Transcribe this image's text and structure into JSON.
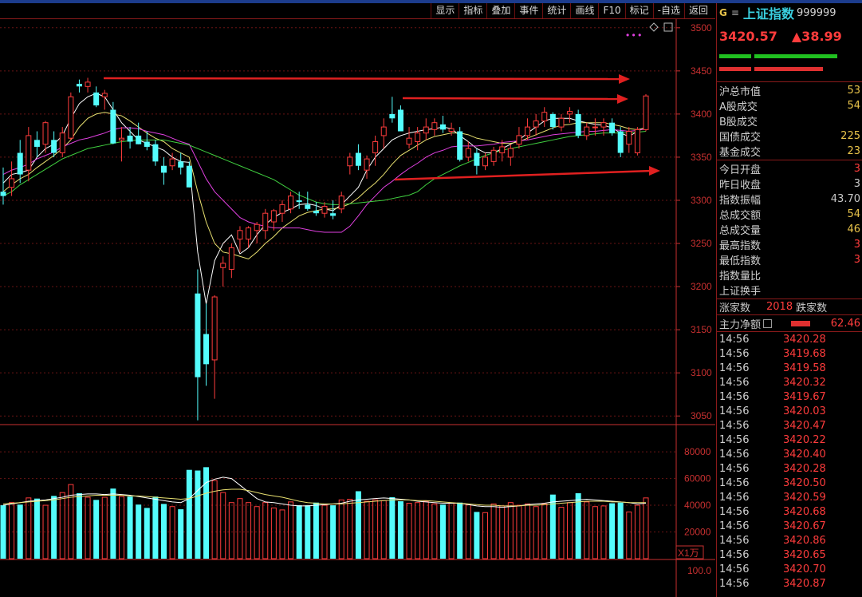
{
  "toolbar": [
    "显示",
    "指标",
    "叠加",
    "事件",
    "统计",
    "画线",
    "F10",
    "标记",
    "-自选",
    "返回"
  ],
  "header": {
    "g": "G",
    "menu": "≡",
    "name": "上证指数",
    "code": "999999"
  },
  "quote": {
    "price": "3420.57",
    "change": "▲38.99"
  },
  "stats": [
    {
      "label": "沪总市值",
      "value": "53",
      "color": "yellow"
    },
    {
      "label": "A股成交",
      "value": "54",
      "color": "yellow"
    },
    {
      "label": "B股成交",
      "value": "",
      "color": "yellow"
    },
    {
      "label": "国债成交",
      "value": "225",
      "color": "yellow"
    },
    {
      "label": "基金成交",
      "value": "23",
      "color": "yellow"
    }
  ],
  "stats2": [
    {
      "label": "今日开盘",
      "value": "3",
      "color": "red"
    },
    {
      "label": "昨日收盘",
      "value": "3",
      "color": "white"
    },
    {
      "label": "指数振幅",
      "value": "43.70",
      "color": "white"
    },
    {
      "label": "总成交额",
      "value": "54",
      "color": "yellow"
    },
    {
      "label": "总成交量",
      "value": "46",
      "color": "yellow"
    },
    {
      "label": "最高指数",
      "value": "3",
      "color": "red"
    },
    {
      "label": "最低指数",
      "value": "3",
      "color": "red"
    },
    {
      "label": "指数量比",
      "value": "",
      "color": "white"
    },
    {
      "label": "上证换手",
      "value": "",
      "color": "white"
    }
  ],
  "updown": {
    "up_label": "涨家数",
    "up_value": "2018",
    "down_label": "跌家数"
  },
  "netflow": {
    "label": "主力净额",
    "value": "62.46"
  },
  "ticks": [
    {
      "t": "14:56",
      "p": "3420.28"
    },
    {
      "t": "14:56",
      "p": "3419.68"
    },
    {
      "t": "14:56",
      "p": "3419.58"
    },
    {
      "t": "14:56",
      "p": "3420.32"
    },
    {
      "t": "14:56",
      "p": "3419.67"
    },
    {
      "t": "14:56",
      "p": "3420.03"
    },
    {
      "t": "14:56",
      "p": "3420.47"
    },
    {
      "t": "14:56",
      "p": "3420.22"
    },
    {
      "t": "14:56",
      "p": "3420.40"
    },
    {
      "t": "14:56",
      "p": "3420.28"
    },
    {
      "t": "14:56",
      "p": "3420.50"
    },
    {
      "t": "14:56",
      "p": "3420.59"
    },
    {
      "t": "14:56",
      "p": "3420.68"
    },
    {
      "t": "14:56",
      "p": "3420.67"
    },
    {
      "t": "14:56",
      "p": "3420.86"
    },
    {
      "t": "14:56",
      "p": "3420.65"
    },
    {
      "t": "14:56",
      "p": "3420.70"
    },
    {
      "t": "14:56",
      "p": "3420.87"
    }
  ],
  "colors": {
    "up": "#ff3c3c",
    "down": "#54fcfc",
    "ma5": "#ffffff",
    "ma10": "#e8e070",
    "ma20": "#e040e0",
    "ma60": "#40d040",
    "axis": "#c83030"
  },
  "chart_data": {
    "type": "candlestick",
    "price_axis": {
      "ticks": [
        3050,
        3100,
        3150,
        3200,
        3250,
        3300,
        3350,
        3400,
        3450,
        3500
      ],
      "range": [
        3040,
        3510
      ]
    },
    "volume_axis": {
      "ticks": [
        20000,
        40000,
        60000,
        80000
      ],
      "unit_label": "X1万",
      "range": [
        0,
        95000
      ]
    },
    "sub_axis": {
      "ticks": [
        "100.0"
      ]
    },
    "candles": [
      [
        3310,
        3338,
        3295,
        3305,
        40000
      ],
      [
        3315,
        3345,
        3305,
        3325,
        42000
      ],
      [
        3355,
        3370,
        3320,
        3330,
        40500
      ],
      [
        3335,
        3385,
        3322,
        3375,
        45500
      ],
      [
        3370,
        3380,
        3350,
        3362,
        45000
      ],
      [
        3365,
        3392,
        3355,
        3390,
        40000
      ],
      [
        3370,
        3380,
        3350,
        3355,
        47000
      ],
      [
        3355,
        3385,
        3350,
        3378,
        49500
      ],
      [
        3372,
        3425,
        3370,
        3420,
        55500
      ],
      [
        3435,
        3440,
        3425,
        3432,
        49000
      ],
      [
        3432,
        3442,
        3425,
        3437,
        46000
      ],
      [
        3425,
        3432,
        3408,
        3410,
        44000
      ],
      [
        3420,
        3428,
        3405,
        3424,
        46000
      ],
      [
        3405,
        3414,
        3365,
        3366,
        52500
      ],
      [
        3370,
        3385,
        3345,
        3372,
        46500
      ],
      [
        3375,
        3385,
        3360,
        3368,
        46500
      ],
      [
        3375,
        3390,
        3365,
        3365,
        40500
      ],
      [
        3368,
        3380,
        3358,
        3362,
        38000
      ],
      [
        3365,
        3370,
        3340,
        3345,
        46500
      ],
      [
        3340,
        3350,
        3318,
        3332,
        41000
      ],
      [
        3340,
        3355,
        3335,
        3348,
        39000
      ],
      [
        3345,
        3355,
        3330,
        3338,
        37000
      ],
      [
        3340,
        3345,
        3315,
        3315,
        66500
      ],
      [
        3192,
        3220,
        3045,
        3095,
        66000
      ],
      [
        3145,
        3180,
        3085,
        3110,
        68500
      ],
      [
        3115,
        3190,
        3070,
        3188,
        58500
      ],
      [
        3222,
        3235,
        3200,
        3227,
        49500
      ],
      [
        3220,
        3250,
        3210,
        3245,
        42000
      ],
      [
        3255,
        3270,
        3240,
        3265,
        45000
      ],
      [
        3255,
        3270,
        3245,
        3268,
        42000
      ],
      [
        3265,
        3275,
        3250,
        3272,
        39000
      ],
      [
        3265,
        3290,
        3255,
        3285,
        42000
      ],
      [
        3275,
        3290,
        3265,
        3288,
        38000
      ],
      [
        3285,
        3300,
        3275,
        3295,
        36500
      ],
      [
        3290,
        3310,
        3285,
        3305,
        42500
      ],
      [
        3300,
        3310,
        3290,
        3298,
        40000
      ],
      [
        3295,
        3310,
        3288,
        3290,
        40000
      ],
      [
        3288,
        3298,
        3282,
        3285,
        42000
      ],
      [
        3285,
        3298,
        3280,
        3293,
        40000
      ],
      [
        3285,
        3300,
        3278,
        3282,
        40000
      ],
      [
        3290,
        3310,
        3285,
        3305,
        44000
      ],
      [
        3340,
        3355,
        3330,
        3350,
        44500
      ],
      [
        3355,
        3365,
        3335,
        3340,
        50500
      ],
      [
        3335,
        3352,
        3325,
        3348,
        43000
      ],
      [
        3355,
        3375,
        3340,
        3368,
        44000
      ],
      [
        3375,
        3395,
        3360,
        3385,
        43500
      ],
      [
        3400,
        3420,
        3390,
        3395,
        46000
      ],
      [
        3405,
        3410,
        3380,
        3380,
        43000
      ],
      [
        3365,
        3385,
        3360,
        3372,
        41500
      ],
      [
        3368,
        3385,
        3358,
        3378,
        42000
      ],
      [
        3378,
        3395,
        3370,
        3385,
        43000
      ],
      [
        3382,
        3395,
        3375,
        3390,
        41000
      ],
      [
        3388,
        3398,
        3378,
        3382,
        40500
      ],
      [
        3380,
        3390,
        3375,
        3383,
        41500
      ],
      [
        3380,
        3385,
        3345,
        3347,
        42000
      ],
      [
        3350,
        3368,
        3345,
        3360,
        40500
      ],
      [
        3355,
        3360,
        3330,
        3340,
        35000
      ],
      [
        3340,
        3355,
        3335,
        3350,
        34500
      ],
      [
        3345,
        3362,
        3340,
        3358,
        41000
      ],
      [
        3355,
        3370,
        3345,
        3362,
        39500
      ],
      [
        3350,
        3365,
        3340,
        3360,
        42000
      ],
      [
        3365,
        3385,
        3360,
        3375,
        40000
      ],
      [
        3375,
        3395,
        3370,
        3385,
        41000
      ],
      [
        3385,
        3400,
        3375,
        3392,
        39000
      ],
      [
        3392,
        3408,
        3385,
        3402,
        41000
      ],
      [
        3400,
        3402,
        3382,
        3385,
        48000
      ],
      [
        3385,
        3400,
        3380,
        3395,
        38500
      ],
      [
        3400,
        3408,
        3390,
        3403,
        42000
      ],
      [
        3400,
        3405,
        3372,
        3375,
        49000
      ],
      [
        3375,
        3390,
        3370,
        3385,
        42500
      ],
      [
        3385,
        3395,
        3375,
        3385,
        39000
      ],
      [
        3385,
        3395,
        3375,
        3390,
        39500
      ],
      [
        3390,
        3395,
        3375,
        3378,
        41500
      ],
      [
        3380,
        3385,
        3350,
        3355,
        42000
      ],
      [
        3365,
        3385,
        3355,
        3380,
        35000
      ],
      [
        3355,
        3385,
        3352,
        3382,
        40000
      ],
      [
        3382,
        3423,
        3380,
        3421,
        45500
      ]
    ],
    "ma_lines": [
      {
        "name": "ma5",
        "values": [
          3320,
          3330,
          3332,
          3335,
          3350,
          3360,
          3365,
          3375,
          3395,
          3412,
          3420,
          3424,
          3420,
          3405,
          3390,
          3380,
          3370,
          3366,
          3362,
          3358,
          3350,
          3345,
          3344,
          3240,
          3180,
          3230,
          3250,
          3260,
          3238,
          3245,
          3260,
          3272,
          3280,
          3286,
          3290,
          3295,
          3296,
          3294,
          3290,
          3288,
          3295,
          3305,
          3315,
          3335,
          3350,
          3360,
          3370,
          3375,
          3378,
          3380,
          3382,
          3383,
          3385,
          3383,
          3375,
          3368,
          3360,
          3355,
          3355,
          3360,
          3365,
          3370,
          3378,
          3385,
          3392,
          3395,
          3395,
          3395,
          3392,
          3390,
          3388,
          3387,
          3384,
          3378,
          3374,
          3380,
          3385
        ]
      },
      {
        "name": "ma10",
        "values": [
          3310,
          3318,
          3325,
          3330,
          3338,
          3345,
          3352,
          3360,
          3370,
          3385,
          3395,
          3400,
          3402,
          3400,
          3398,
          3392,
          3385,
          3378,
          3372,
          3368,
          3360,
          3355,
          3350,
          3310,
          3275,
          3250,
          3240,
          3238,
          3235,
          3232,
          3240,
          3250,
          3258,
          3268,
          3275,
          3282,
          3286,
          3288,
          3290,
          3290,
          3292,
          3296,
          3303,
          3312,
          3320,
          3330,
          3342,
          3352,
          3358,
          3364,
          3370,
          3374,
          3376,
          3378,
          3378,
          3376,
          3372,
          3370,
          3368,
          3366,
          3366,
          3368,
          3372,
          3376,
          3380,
          3384,
          3387,
          3388,
          3390,
          3390,
          3390,
          3390,
          3388,
          3386,
          3383,
          3382,
          3384
        ]
      },
      {
        "name": "ma20",
        "values": [
          3330,
          3335,
          3338,
          3342,
          3348,
          3352,
          3356,
          3362,
          3366,
          3370,
          3372,
          3375,
          3378,
          3382,
          3384,
          3384,
          3383,
          3380,
          3378,
          3376,
          3372,
          3368,
          3365,
          3345,
          3325,
          3310,
          3300,
          3290,
          3280,
          3275,
          3272,
          3270,
          3268,
          3268,
          3268,
          3268,
          3266,
          3264,
          3263,
          3263,
          3263,
          3270,
          3282,
          3295,
          3305,
          3315,
          3322,
          3330,
          3337,
          3343,
          3350,
          3355,
          3358,
          3362,
          3363,
          3363,
          3363,
          3364,
          3365,
          3367,
          3368,
          3369,
          3370,
          3372,
          3374,
          3376,
          3377,
          3378,
          3379,
          3380,
          3380,
          3381,
          3382,
          3381,
          3380,
          3381,
          3383
        ]
      },
      {
        "name": "ma60",
        "values": [
          3305,
          3310,
          3318,
          3324,
          3330,
          3336,
          3342,
          3348,
          3352,
          3356,
          3360,
          3362,
          3364,
          3366,
          3368,
          3369,
          3370,
          3370,
          3370,
          3370,
          3368,
          3366,
          3364,
          3360,
          3356,
          3352,
          3348,
          3344,
          3340,
          3336,
          3332,
          3328,
          3324,
          3318,
          3312,
          3306,
          3302,
          3298,
          3296,
          3295,
          3295,
          3296,
          3297,
          3298,
          3299,
          3300,
          3302,
          3304,
          3306,
          3310,
          3318,
          3325,
          3330,
          3335,
          3340,
          3344,
          3348,
          3352,
          3355,
          3358,
          3360,
          3362,
          3364,
          3366,
          3368,
          3370,
          3372,
          3374,
          3375,
          3376,
          3377,
          3378,
          3378,
          3378,
          3378,
          3379,
          3380
        ]
      }
    ],
    "volume_ma": [
      {
        "name": "vma5",
        "values": [
          40000,
          41000,
          42000,
          43000,
          43500,
          44000,
          45000,
          46000,
          47500,
          48000,
          48500,
          48500,
          48000,
          48500,
          48000,
          47500,
          46500,
          45500,
          44500,
          43500,
          42500,
          42000,
          45000,
          51000,
          57000,
          59500,
          61000,
          60000,
          55000,
          50000,
          45000,
          42500,
          42000,
          41000,
          40000,
          39500,
          39500,
          40000,
          40500,
          41000,
          41500,
          43000,
          44000,
          44500,
          45000,
          45500,
          45000,
          44500,
          44000,
          43000,
          42500,
          42000,
          41500,
          41500,
          41500,
          40500,
          39500,
          39000,
          39000,
          38500,
          39000,
          39500,
          40500,
          41000,
          41500,
          42500,
          43000,
          43500,
          44000,
          44500,
          44000,
          43500,
          43000,
          42500,
          42000,
          41000,
          41500
        ]
      },
      {
        "name": "vma10",
        "values": [
          41000,
          41500,
          42000,
          42500,
          43000,
          43500,
          44000,
          45000,
          46000,
          46500,
          47000,
          47500,
          47500,
          47500,
          47500,
          47000,
          47000,
          46500,
          46000,
          45500,
          45000,
          44500,
          45000,
          47000,
          49000,
          50500,
          51500,
          52000,
          52000,
          51000,
          49500,
          48000,
          47000,
          46000,
          44500,
          43000,
          42000,
          41500,
          41000,
          41000,
          41000,
          41500,
          42000,
          42500,
          43000,
          43500,
          44000,
          44000,
          44000,
          43500,
          43500,
          43000,
          42500,
          42000,
          41500,
          41000,
          40500,
          40000,
          40000,
          39500,
          39500,
          39500,
          40000,
          40000,
          40500,
          41000,
          41500,
          42000,
          42500,
          43000,
          43000,
          43000,
          42500,
          42500,
          42000,
          42000,
          42000
        ]
      }
    ]
  }
}
